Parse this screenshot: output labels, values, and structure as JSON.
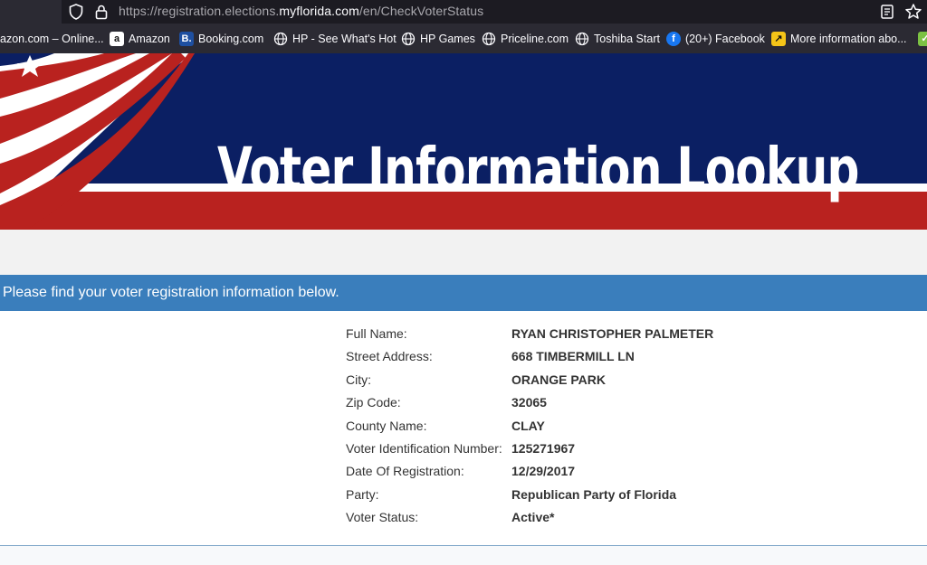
{
  "browser": {
    "url_prefix": "https://registration.elections.",
    "url_domain": "myflorida.com",
    "url_path": "/en/CheckVoterStatus",
    "bookmarks": [
      {
        "label": "azon.com – Online...",
        "icon": "amazon-partial-icon"
      },
      {
        "label": "Amazon",
        "icon": "amazon-icon"
      },
      {
        "label": "Booking.com",
        "icon": "booking-icon"
      },
      {
        "label": "HP - See What's Hot",
        "icon": "globe-icon"
      },
      {
        "label": "HP Games",
        "icon": "globe-icon"
      },
      {
        "label": "Priceline.com",
        "icon": "globe-icon"
      },
      {
        "label": "Toshiba Start",
        "icon": "globe-icon"
      },
      {
        "label": "(20+) Facebook",
        "icon": "facebook-icon"
      },
      {
        "label": "More information abo...",
        "icon": "external-link-icon"
      }
    ]
  },
  "banner": {
    "title": "Voter Information Lookup"
  },
  "info_message": "Please find your voter registration information below.",
  "voter": [
    {
      "label": "Full Name:",
      "value": "RYAN CHRISTOPHER PALMETER"
    },
    {
      "label": "Street Address:",
      "value": "668 TIMBERMILL LN"
    },
    {
      "label": "City:",
      "value": "ORANGE PARK"
    },
    {
      "label": "Zip Code:",
      "value": "32065"
    },
    {
      "label": "County Name:",
      "value": "CLAY"
    },
    {
      "label": "Voter Identification Number:",
      "value": "125271967"
    },
    {
      "label": "Date Of Registration:",
      "value": "12/29/2017"
    },
    {
      "label": "Party:",
      "value": "Republican Party of Florida"
    },
    {
      "label": "Voter Status:",
      "value": "Active*"
    }
  ],
  "colors": {
    "navy": "#0b1f63",
    "flag_red": "#b9221f",
    "info_blue": "#3a7ebc",
    "chrome_dark": "#1c1b22"
  }
}
